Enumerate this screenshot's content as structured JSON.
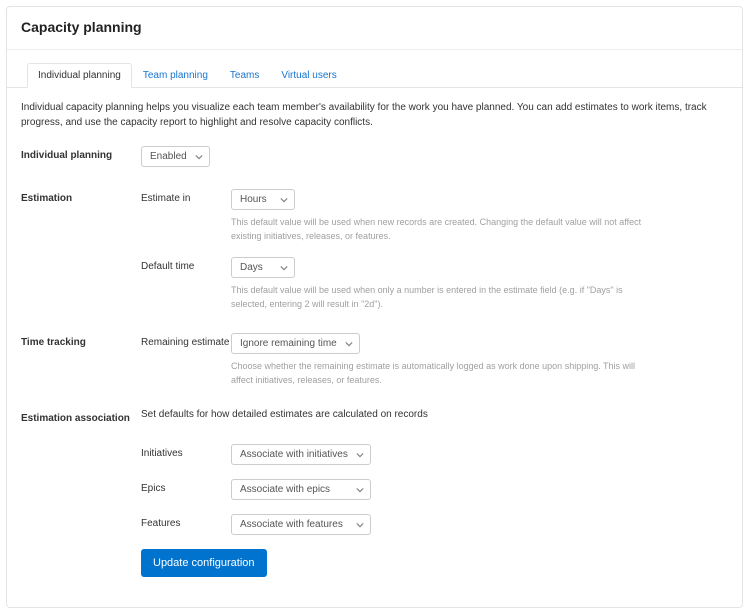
{
  "page": {
    "title": "Capacity planning"
  },
  "tabs": [
    {
      "label": "Individual planning"
    },
    {
      "label": "Team planning"
    },
    {
      "label": "Teams"
    },
    {
      "label": "Virtual users"
    }
  ],
  "intro": "Individual capacity planning helps you visualize each team member's availability for the work you have planned. You can add estimates to work items, track progress, and use the capacity report to highlight and resolve capacity conflicts.",
  "individual_planning": {
    "label": "Individual planning",
    "value": "Enabled"
  },
  "estimation": {
    "section": "Estimation",
    "estimate_in": {
      "label": "Estimate in",
      "value": "Hours",
      "help": "This default value will be used when new records are created. Changing the default value will not affect existing initiatives, releases, or features."
    },
    "default_time": {
      "label": "Default time",
      "value": "Days",
      "help": "This default value will be used when only a number is entered in the estimate field (e.g. if \"Days\" is selected, entering 2 will result in \"2d\")."
    }
  },
  "time_tracking": {
    "section": "Time tracking",
    "remaining_estimate": {
      "label": "Remaining estimate",
      "value": "Ignore remaining time",
      "help": "Choose whether the remaining estimate is automatically logged as work done upon shipping. This will affect initiatives, releases, or features."
    }
  },
  "estimation_association": {
    "section": "Estimation association",
    "subhead": "Set defaults for how detailed estimates are calculated on records",
    "initiatives": {
      "label": "Initiatives",
      "value": "Associate with initiatives"
    },
    "epics": {
      "label": "Epics",
      "value": "Associate with epics"
    },
    "features": {
      "label": "Features",
      "value": "Associate with features"
    }
  },
  "submit": {
    "label": "Update configuration"
  }
}
